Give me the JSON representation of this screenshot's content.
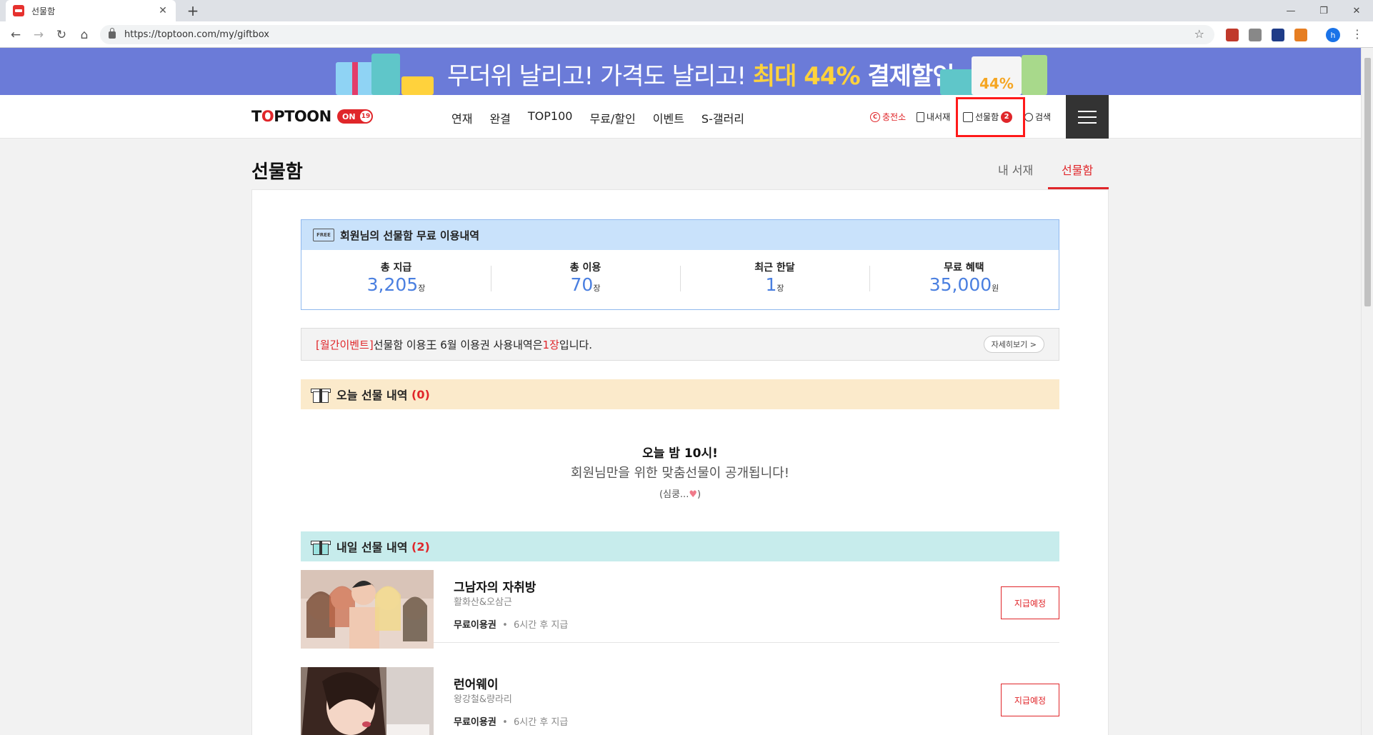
{
  "browser": {
    "tab_title": "선물함",
    "tab_close": "✕",
    "new_tab": "+",
    "url": "https://toptoon.com/my/giftbox",
    "profile_initial": "h",
    "win_minimize": "—",
    "win_restore": "❐",
    "win_close": "✕"
  },
  "banner": {
    "text_plain": "무더위 날리고! 가격도 날리고! ",
    "text_highlight": "최대 44%",
    "text_bold": " 결제할인",
    "badge": "44%"
  },
  "header": {
    "logo_prefix": "T",
    "logo_o": "O",
    "logo_suffix": "PTOON",
    "on_label": "ON",
    "age_badge": "19",
    "nav": [
      "연재",
      "완결",
      "TOP100",
      "무료/할인",
      "이벤트",
      "S-갤러리"
    ],
    "util": {
      "charge": "충전소",
      "charge_icon_char": "C",
      "library": "내서재",
      "giftbox": "선물함",
      "giftbox_count": "2",
      "search": "검색"
    }
  },
  "page": {
    "title": "선물함",
    "tabs": [
      "내 서재",
      "선물함"
    ],
    "active_tab": "선물함"
  },
  "stats": {
    "free_icon_text": "FREE",
    "heading": "회원님의 선물함 무료 이용내역",
    "items": [
      {
        "label": "총 지급",
        "value": "3,205",
        "unit": "장"
      },
      {
        "label": "총 이용",
        "value": "70",
        "unit": "장"
      },
      {
        "label": "최근 한달",
        "value": "1",
        "unit": "장"
      },
      {
        "label": "무료 혜택",
        "value": "35,000",
        "unit": "원"
      }
    ]
  },
  "notice": {
    "tag": "[월간이벤트]",
    "text_before": " 선물함 이용王 6월 이용권 사용내역은 ",
    "count": "1장",
    "text_after": " 입니다.",
    "more": "자세히보기 >"
  },
  "today": {
    "heading": "오늘 선물 내역",
    "count": "(0)",
    "msg_title": "오늘 밤 10시!",
    "msg_sub": "회원님만을 위한 맞춤선물이 공개됩니다!",
    "msg_small_prefix": "(심쿵...",
    "msg_small_suffix": ")"
  },
  "tomorrow": {
    "heading": "내일 선물 내역",
    "count": "(2)",
    "items": [
      {
        "title": "그남자의 자취방",
        "author": "활화산&오삼근",
        "type": "무료이용권",
        "when": "6시간 후 지급",
        "button": "지급예정"
      },
      {
        "title": "런어웨이",
        "author": "왕강철&량라리",
        "type": "무료이용권",
        "when": "6시간 후 지급",
        "button": "지급예정"
      }
    ]
  },
  "colors": {
    "accent_red": "#e0262a",
    "stat_blue": "#4a7fe0",
    "banner_bg": "#6b7bd8"
  }
}
